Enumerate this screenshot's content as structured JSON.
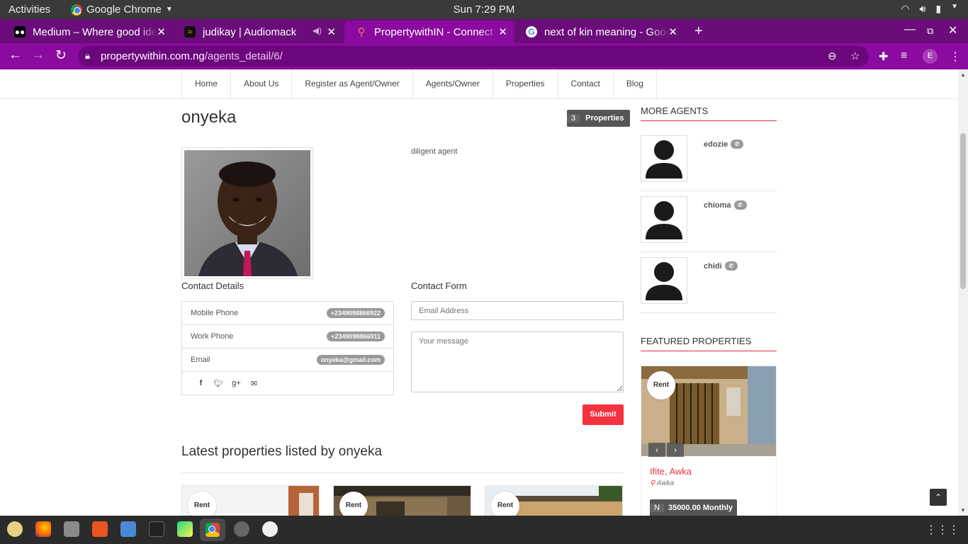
{
  "gnome": {
    "activities": "Activities",
    "app_name": "Google Chrome",
    "clock": "Sun  7:29 PM"
  },
  "tabs": [
    {
      "title": "Medium – Where good ideas find you",
      "favicon": "medium-icon"
    },
    {
      "title": "judikay | Audiomack",
      "favicon": "audiomack-icon"
    },
    {
      "title": "PropertywithIN - Connect",
      "favicon": "map-pin-icon"
    },
    {
      "title": "next of kin meaning - Google Search",
      "favicon": "google-icon"
    }
  ],
  "omnibox": {
    "domain": "propertywithin.com.ng",
    "path": "/agents_detail/6/"
  },
  "profile_initial": "E",
  "nav": [
    "Home",
    "About Us",
    "Register as Agent/Owner",
    "Agents/Owner",
    "Properties",
    "Contact",
    "Blog"
  ],
  "agent": {
    "name": "onyeka",
    "property_count": "3",
    "property_label": "Properties",
    "description": "diligent agent"
  },
  "contact_details": {
    "heading": "Contact Details",
    "rows": [
      {
        "label": "Mobile Phone",
        "value": "+2349098866922"
      },
      {
        "label": "Work Phone",
        "value": "+2349098866911"
      },
      {
        "label": "Email",
        "value": "onyeka@gmail.com"
      }
    ]
  },
  "contact_form": {
    "heading": "Contact Form",
    "email_placeholder": "Email Address",
    "message_placeholder": "Your message",
    "submit": "Submit"
  },
  "latest": {
    "title": "Latest properties listed by onyeka",
    "cards": [
      {
        "badge": "Rent"
      },
      {
        "badge": "Rent"
      },
      {
        "badge": "Rent"
      }
    ]
  },
  "more_agents": {
    "title": "MORE AGENTS",
    "items": [
      {
        "name": "edozie"
      },
      {
        "name": "chioma"
      },
      {
        "name": "chidi"
      }
    ]
  },
  "featured": {
    "title": "FEATURED PROPERTIES",
    "badge": "Rent",
    "name": "Ifite, Awka",
    "location": "Awka",
    "currency": "N",
    "price": "35000.00 Monthly"
  },
  "colors": {
    "chrome_frame": "#6a0d7a",
    "chrome_toolbar": "#8b0aa0",
    "accent_red": "#e5323f"
  }
}
